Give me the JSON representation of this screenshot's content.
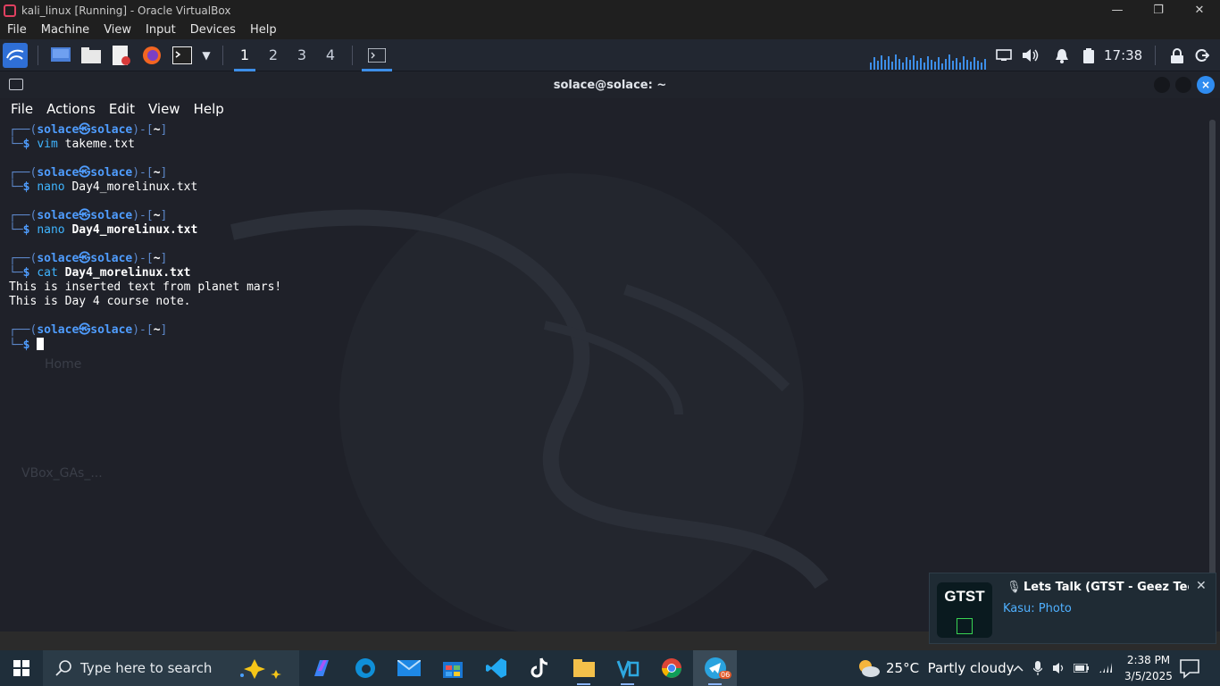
{
  "vbox": {
    "title": "kali_linux [Running] - Oracle VirtualBox",
    "menu": [
      "File",
      "Machine",
      "View",
      "Input",
      "Devices",
      "Help"
    ],
    "controls": {
      "minimize": "—",
      "restore": "❐",
      "close": "✕"
    }
  },
  "kali_panel": {
    "workspaces": [
      "1",
      "2",
      "3",
      "4"
    ],
    "active_workspace": "1",
    "clock": "17:38"
  },
  "terminal": {
    "title": "solace@solace: ~",
    "close_glyph": "×",
    "menu": [
      "File",
      "Actions",
      "Edit",
      "View",
      "Help"
    ],
    "prompt": {
      "user": "solace",
      "skull": "㉿",
      "host": "solace",
      "dir": "~",
      "dollar": "$"
    },
    "commands": [
      {
        "cmd": "vim",
        "arg": "takeme.txt",
        "arg_bold": false,
        "output": []
      },
      {
        "cmd": "nano",
        "arg": "Day4_morelinux.txt",
        "arg_bold": false,
        "output": []
      },
      {
        "cmd": "nano",
        "arg": "Day4_morelinux.txt",
        "arg_bold": true,
        "output": []
      },
      {
        "cmd": "cat",
        "arg": "Day4_morelinux.txt",
        "arg_bold": true,
        "output": [
          "This is inserted text from planet mars!",
          "This is Day 4 course note."
        ]
      }
    ],
    "desktop_ghost": {
      "home": "Home",
      "vbox": "VBox_GAs_..."
    }
  },
  "toast": {
    "title": "Lets Talk (GTST - Geez Tech S...",
    "subtitle": "Kasu: Photo",
    "thumb_text": "GTST",
    "close": "✕"
  },
  "taskbar": {
    "search_placeholder": "Type here to search",
    "weather": "25°C  Partly cloudy",
    "time": "2:38 PM",
    "date": "3/5/2025",
    "telegram_badge": "06"
  }
}
